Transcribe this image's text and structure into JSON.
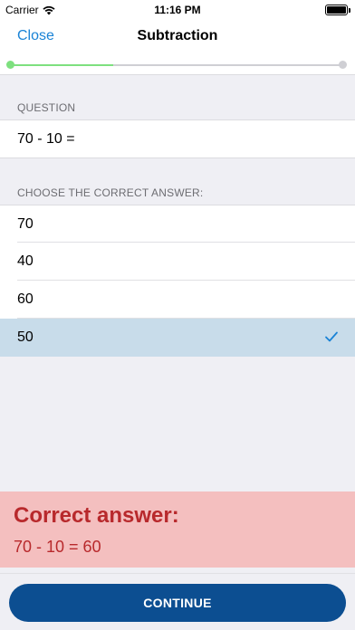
{
  "status_bar": {
    "carrier": "Carrier",
    "time": "11:16 PM"
  },
  "nav": {
    "close_label": "Close",
    "title": "Subtraction"
  },
  "progress": {
    "fraction": 0.31
  },
  "question": {
    "header": "QUESTION",
    "text": "70 - 10 ="
  },
  "answers": {
    "header": "CHOOSE THE CORRECT ANSWER:",
    "options": [
      {
        "label": "70",
        "selected": false
      },
      {
        "label": "40",
        "selected": false
      },
      {
        "label": "60",
        "selected": false
      },
      {
        "label": "50",
        "selected": true
      }
    ]
  },
  "feedback": {
    "title": "Correct answer:",
    "detail": "70 - 10 = 60"
  },
  "footer": {
    "continue_label": "CONTINUE"
  },
  "colors": {
    "accent": "#1a83d6",
    "progress": "#7ee07f",
    "selected_row": "#c8dcea",
    "feedback_bg": "#f4bfbf",
    "feedback_text": "#b8292c",
    "button": "#0c4e91"
  }
}
